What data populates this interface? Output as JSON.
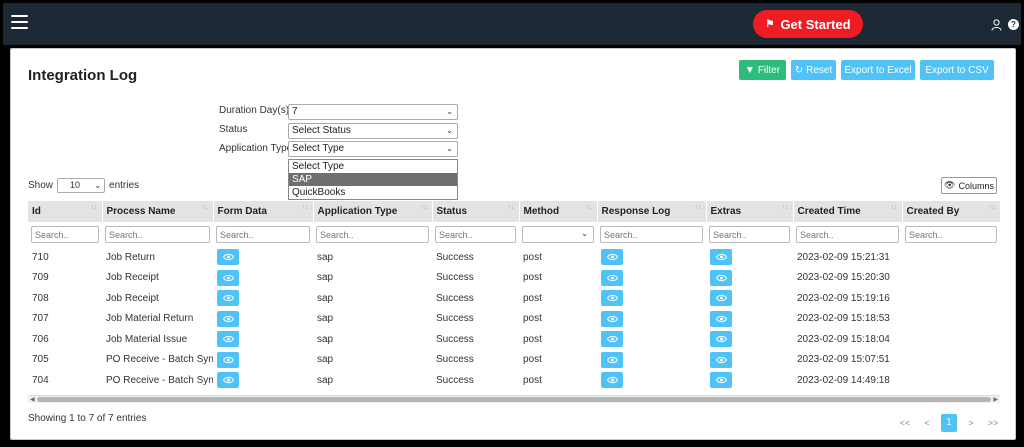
{
  "topbar": {
    "cta_label": "Get Started"
  },
  "page": {
    "title": "Integration Log"
  },
  "toolbar": {
    "filter_label": "Filter",
    "reset_label": "Reset",
    "excel_label": "Export to Excel",
    "csv_label": "Export to CSV"
  },
  "filters": {
    "duration": {
      "label": "Duration Day(s)",
      "value": "7"
    },
    "status": {
      "label": "Status",
      "value": "Select Status"
    },
    "app_type": {
      "label": "Application Type",
      "value": "Select Type"
    },
    "dropdown_options": [
      "Select Type",
      "SAP",
      "QuickBooks"
    ],
    "dropdown_selected": "SAP"
  },
  "length": {
    "show": "Show",
    "value": "10",
    "entries": "entries"
  },
  "columns_label": "Columns",
  "table": {
    "headers": [
      "Id",
      "Process Name",
      "Form Data",
      "Application Type",
      "Status",
      "Method",
      "Response Log",
      "Extras",
      "Created Time",
      "Created By"
    ],
    "search_placeholder": "Search..",
    "rows": [
      {
        "id": "710",
        "process": "Job Return",
        "app": "sap",
        "status": "Success",
        "method": "post",
        "time": "2023-02-09 15:21:31"
      },
      {
        "id": "709",
        "process": "Job Receipt",
        "app": "sap",
        "status": "Success",
        "method": "post",
        "time": "2023-02-09 15:20:30"
      },
      {
        "id": "708",
        "process": "Job Receipt",
        "app": "sap",
        "status": "Success",
        "method": "post",
        "time": "2023-02-09 15:19:16"
      },
      {
        "id": "707",
        "process": "Job Material Return",
        "app": "sap",
        "status": "Success",
        "method": "post",
        "time": "2023-02-09 15:18:53"
      },
      {
        "id": "706",
        "process": "Job Material Issue",
        "app": "sap",
        "status": "Success",
        "method": "post",
        "time": "2023-02-09 15:18:04"
      },
      {
        "id": "705",
        "process": "PO Receive - Batch Sync",
        "app": "sap",
        "status": "Success",
        "method": "post",
        "time": "2023-02-09 15:07:51"
      },
      {
        "id": "704",
        "process": "PO Receive - Batch Sync",
        "app": "sap",
        "status": "Success",
        "method": "post",
        "time": "2023-02-09 14:49:18"
      }
    ]
  },
  "footer": {
    "info": "Showing 1 to 7 of 7 entries",
    "first": "<<",
    "prev": "<",
    "current_page": "1",
    "next": ">",
    "last": ">>"
  },
  "colors": {
    "topbar": "#1c2833",
    "cta": "#ee1d23",
    "info": "#4fc3f7",
    "success": "#2dbb7e"
  }
}
